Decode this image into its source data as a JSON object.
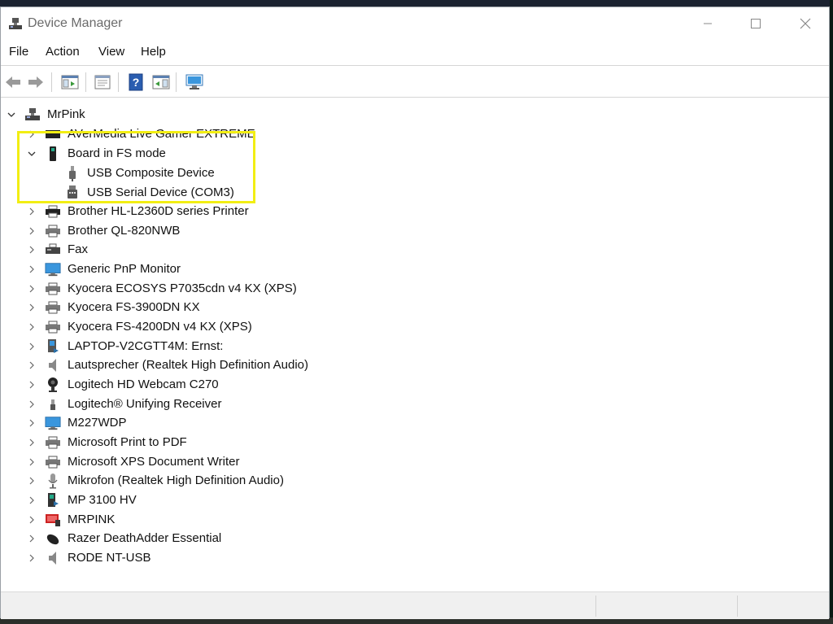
{
  "window": {
    "title": "Device Manager"
  },
  "menu": [
    {
      "label": "File"
    },
    {
      "label": "Action"
    },
    {
      "label": "View"
    },
    {
      "label": "Help"
    }
  ],
  "toolbar": [
    {
      "name": "back-arrow-icon"
    },
    {
      "name": "forward-arrow-icon"
    },
    {
      "name": "show-hide-console-tree-icon"
    },
    {
      "name": "properties-icon"
    },
    {
      "name": "help-icon"
    },
    {
      "name": "action-pane-icon"
    },
    {
      "name": "scan-hardware-icon"
    }
  ],
  "tree": {
    "root": {
      "label": "MrPink",
      "expanded": true,
      "icon": "computer-icon"
    },
    "items": [
      {
        "label": "AVerMedia Live Gamer EXTREME",
        "icon": "capture-card-icon",
        "expanded": false
      },
      {
        "label": "Board in FS mode",
        "icon": "board-icon",
        "expanded": true,
        "children": [
          {
            "label": "USB Composite Device",
            "icon": "usb-plug-icon"
          },
          {
            "label": "USB Serial Device (COM3)",
            "icon": "usb-serial-icon"
          }
        ]
      },
      {
        "label": "Brother HL-L2360D series Printer",
        "icon": "printer-icon",
        "expanded": false
      },
      {
        "label": "Brother QL-820NWB",
        "icon": "printer-icon",
        "expanded": false
      },
      {
        "label": "Fax",
        "icon": "fax-icon",
        "expanded": false
      },
      {
        "label": "Generic PnP Monitor",
        "icon": "monitor-icon",
        "expanded": false
      },
      {
        "label": "Kyocera ECOSYS P7035cdn v4 KX (XPS)",
        "icon": "printer-icon",
        "expanded": false
      },
      {
        "label": "Kyocera FS-3900DN KX",
        "icon": "printer-icon",
        "expanded": false
      },
      {
        "label": "Kyocera FS-4200DN v4 KX (XPS)",
        "icon": "printer-icon",
        "expanded": false
      },
      {
        "label": "LAPTOP-V2CGTT4M: Ernst:",
        "icon": "media-device-icon",
        "expanded": false
      },
      {
        "label": "Lautsprecher (Realtek High Definition Audio)",
        "icon": "speaker-icon",
        "expanded": false
      },
      {
        "label": "Logitech HD Webcam C270",
        "icon": "webcam-icon",
        "expanded": false
      },
      {
        "label": "Logitech® Unifying Receiver",
        "icon": "usb-receiver-icon",
        "expanded": false
      },
      {
        "label": "M227WDP",
        "icon": "monitor-icon",
        "expanded": false
      },
      {
        "label": "Microsoft Print to PDF",
        "icon": "printer-icon",
        "expanded": false
      },
      {
        "label": "Microsoft XPS Document Writer",
        "icon": "printer-icon",
        "expanded": false
      },
      {
        "label": "Mikrofon (Realtek High Definition Audio)",
        "icon": "microphone-icon",
        "expanded": false
      },
      {
        "label": "MP 3100 HV",
        "icon": "media-player-icon",
        "expanded": false
      },
      {
        "label": "MRPINK",
        "icon": "computer-red-icon",
        "expanded": false
      },
      {
        "label": "Razer DeathAdder Essential",
        "icon": "mouse-icon",
        "expanded": false
      },
      {
        "label": "RODE NT-USB",
        "icon": "speaker-icon",
        "expanded": false
      }
    ]
  },
  "colors": {
    "highlight": "#f2ee13",
    "monitor": "#3a96dd",
    "help_icon": "#2a5db0"
  }
}
